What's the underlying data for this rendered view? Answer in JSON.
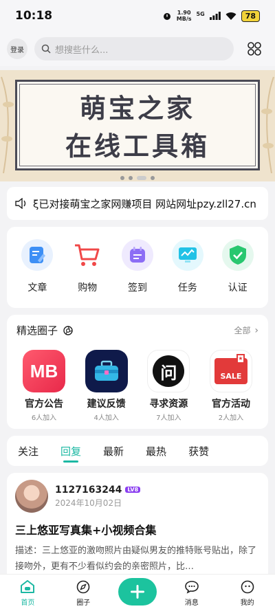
{
  "status_bar": {
    "time": "10:18",
    "net_speed_value": "1.90",
    "net_speed_unit": "MB/s",
    "network": "5G",
    "battery": "78"
  },
  "header": {
    "login_label": "登录",
    "search_placeholder": "想搜些什么..."
  },
  "banner": {
    "line1": "萌宝之家",
    "line2": "在线工具箱"
  },
  "notice": {
    "text": "ξ已对接萌宝之家网赚项目 网站网址pzy.zll27.cn"
  },
  "quick_links": [
    {
      "label": "文章",
      "icon": "article-icon",
      "color": "#3d8ff5"
    },
    {
      "label": "购物",
      "icon": "shopping-cart-icon",
      "color": "#f04848"
    },
    {
      "label": "签到",
      "icon": "calendar-icon",
      "color": "#8c6df5"
    },
    {
      "label": "任务",
      "icon": "monitor-chart-icon",
      "color": "#21c2e6"
    },
    {
      "label": "认证",
      "icon": "shield-check-icon",
      "color": "#28c76f"
    }
  ],
  "circles": {
    "title": "精选圈子",
    "all_label": "全部",
    "items": [
      {
        "name": "官方公告",
        "count": "6人加入",
        "logo_text": "MB",
        "color": "#f0405a"
      },
      {
        "name": "建议反馈",
        "count": "4人加入",
        "logo_text": "",
        "color": "#0f1a4a"
      },
      {
        "name": "寻求资源",
        "count": "7人加入",
        "logo_text": "问",
        "color": "#111111"
      },
      {
        "name": "官方活动",
        "count": "2人加入",
        "logo_text": "SALE",
        "color": "#e23a3a"
      }
    ]
  },
  "tabs": [
    "关注",
    "回复",
    "最新",
    "最热",
    "获赞"
  ],
  "active_tab": "回复",
  "post": {
    "username": "1127163244",
    "level": "LV8",
    "date": "2024年10月02日",
    "title": "三上悠亚写真集+小视频合集",
    "description": "描述：三上悠亚的激吻照片由疑似男友的推特账号贴出，除了接吻外，更有不少看似约会的亲密照片，比…"
  },
  "bottom_nav": {
    "home": "首页",
    "circles": "圈子",
    "messages": "消息",
    "mine": "我的"
  },
  "accent_color": "#1cb8a3"
}
